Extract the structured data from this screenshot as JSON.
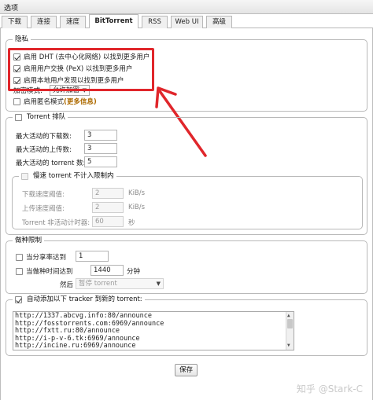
{
  "window": {
    "title": "选项"
  },
  "tabs": [
    {
      "label": "下载"
    },
    {
      "label": "连接"
    },
    {
      "label": "速度"
    },
    {
      "label": "BitTorrent"
    },
    {
      "label": "RSS"
    },
    {
      "label": "Web UI"
    },
    {
      "label": "高级"
    }
  ],
  "privacy": {
    "legend": "隐私",
    "dht": {
      "label": "启用 DHT (去中心化网络) 以找到更多用户",
      "checked": true
    },
    "pex": {
      "label": "启用用户交换 (PeX) 以找到更多用户",
      "checked": true
    },
    "lsd": {
      "label": "启用本地用户发现以找到更多用户",
      "checked": true
    },
    "encryption_label": "加密模式:",
    "encryption_value": "允许加密",
    "anonymous": {
      "label": "启用匿名模式",
      "more_info": "(更多信息)",
      "checked": false
    }
  },
  "queue": {
    "legend": "Torrent 排队",
    "checked": false,
    "max_downloads_label": "最大活动的下载数:",
    "max_downloads_value": "3",
    "max_uploads_label": "最大活动的上传数:",
    "max_uploads_value": "3",
    "max_torrents_label": "最大活动的 torrent 数:",
    "max_torrents_value": "5",
    "slow": {
      "legend": "慢速 torrent 不计入限制内",
      "checked": false,
      "dl_label": "下载速度阈值:",
      "dl_value": "2",
      "dl_unit": "KiB/s",
      "ul_label": "上传速度阈值:",
      "ul_value": "2",
      "ul_unit": "KiB/s",
      "timer_label": "Torrent 非活动计时器:",
      "timer_value": "60",
      "timer_unit": "秒"
    }
  },
  "seeding": {
    "legend": "做种限制",
    "ratio_label": "当分享率达到",
    "ratio_value": "1",
    "time_label": "当做种时间达到",
    "time_value": "1440",
    "time_unit": "分钟",
    "then_label": "然后",
    "then_value": "暂停 torrent"
  },
  "trackers": {
    "legend": "自动添加以下 tracker 到新的 torrent:",
    "checked": true,
    "lines": [
      "http://1337.abcvg.info:80/announce",
      "http://fosstorrents.com:6969/announce",
      "http://fxtt.ru:80/announce",
      "http://i-p-v-6.tk:6969/announce",
      "http://incine.ru:6969/announce"
    ]
  },
  "save_label": "保存",
  "watermark": "知乎 @Stark-C",
  "colors": {
    "highlight": "#e0262b",
    "link": "#ad6a00"
  }
}
